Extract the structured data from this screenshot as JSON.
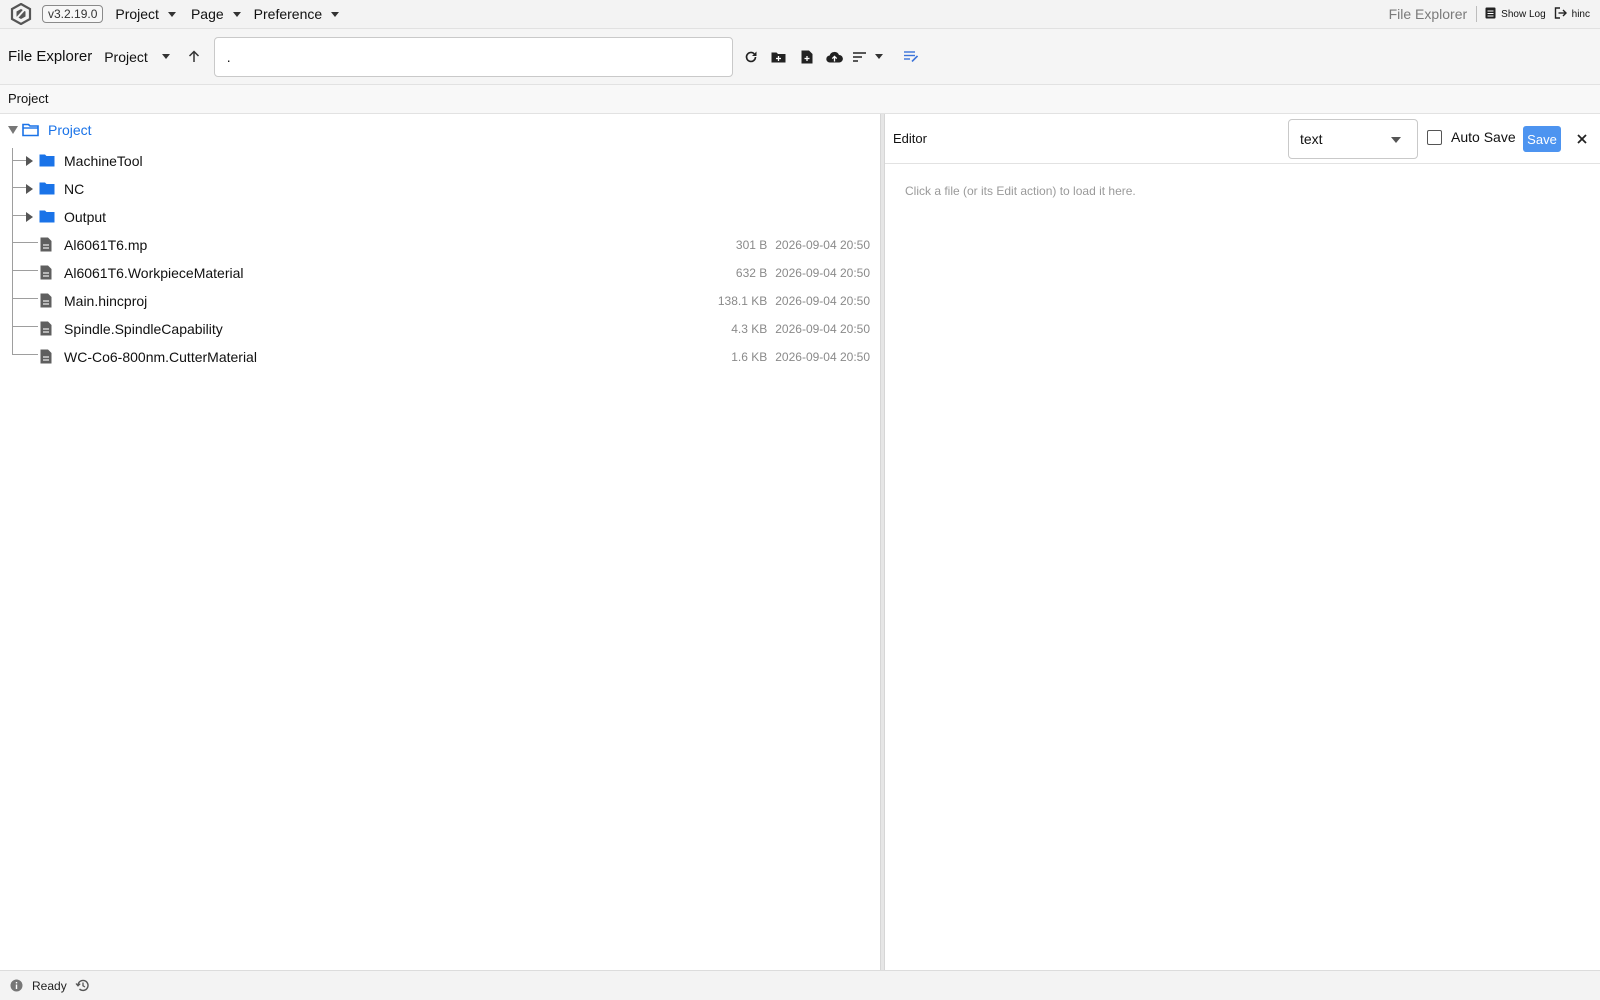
{
  "app": {
    "version": "v3.2.19.0",
    "menus": [
      {
        "label": "Project"
      },
      {
        "label": "Page"
      },
      {
        "label": "Preference"
      }
    ],
    "current_page": "File Explorer",
    "show_log_label": "Show Log",
    "user_label": "hinc"
  },
  "toolbar": {
    "title": "File Explorer",
    "root_select": "Project",
    "path_value": ".",
    "icons": [
      "up-arrow-icon",
      "refresh-icon",
      "new-folder-icon",
      "new-file-icon",
      "upload-icon",
      "sort-icon",
      "wrap-icon"
    ]
  },
  "panel_label": "Project",
  "tree": {
    "root": {
      "label": "Project",
      "color": "#1a73e8"
    },
    "folders": [
      {
        "name": "MachineTool"
      },
      {
        "name": "NC"
      },
      {
        "name": "Output"
      }
    ],
    "files": [
      {
        "name": "Al6061T6.mp",
        "size": "301 B",
        "modified": "2026-09-04 20:50"
      },
      {
        "name": "Al6061T6.WorkpieceMaterial",
        "size": "632 B",
        "modified": "2026-09-04 20:50"
      },
      {
        "name": "Main.hincproj",
        "size": "138.1 KB",
        "modified": "2026-09-04 20:50"
      },
      {
        "name": "Spindle.SpindleCapability",
        "size": "4.3 KB",
        "modified": "2026-09-04 20:50"
      },
      {
        "name": "WC-Co6-800nm.CutterMaterial",
        "size": "1.6 KB",
        "modified": "2026-09-04 20:50"
      }
    ],
    "folder_color": "#1a73e8"
  },
  "editor": {
    "title": "Editor",
    "mode": "text",
    "autosave_label": "Auto Save",
    "autosave_checked": false,
    "save_label": "Save",
    "hint": "Click a file (or its Edit action) to load it here."
  },
  "status": {
    "text": "Ready"
  }
}
